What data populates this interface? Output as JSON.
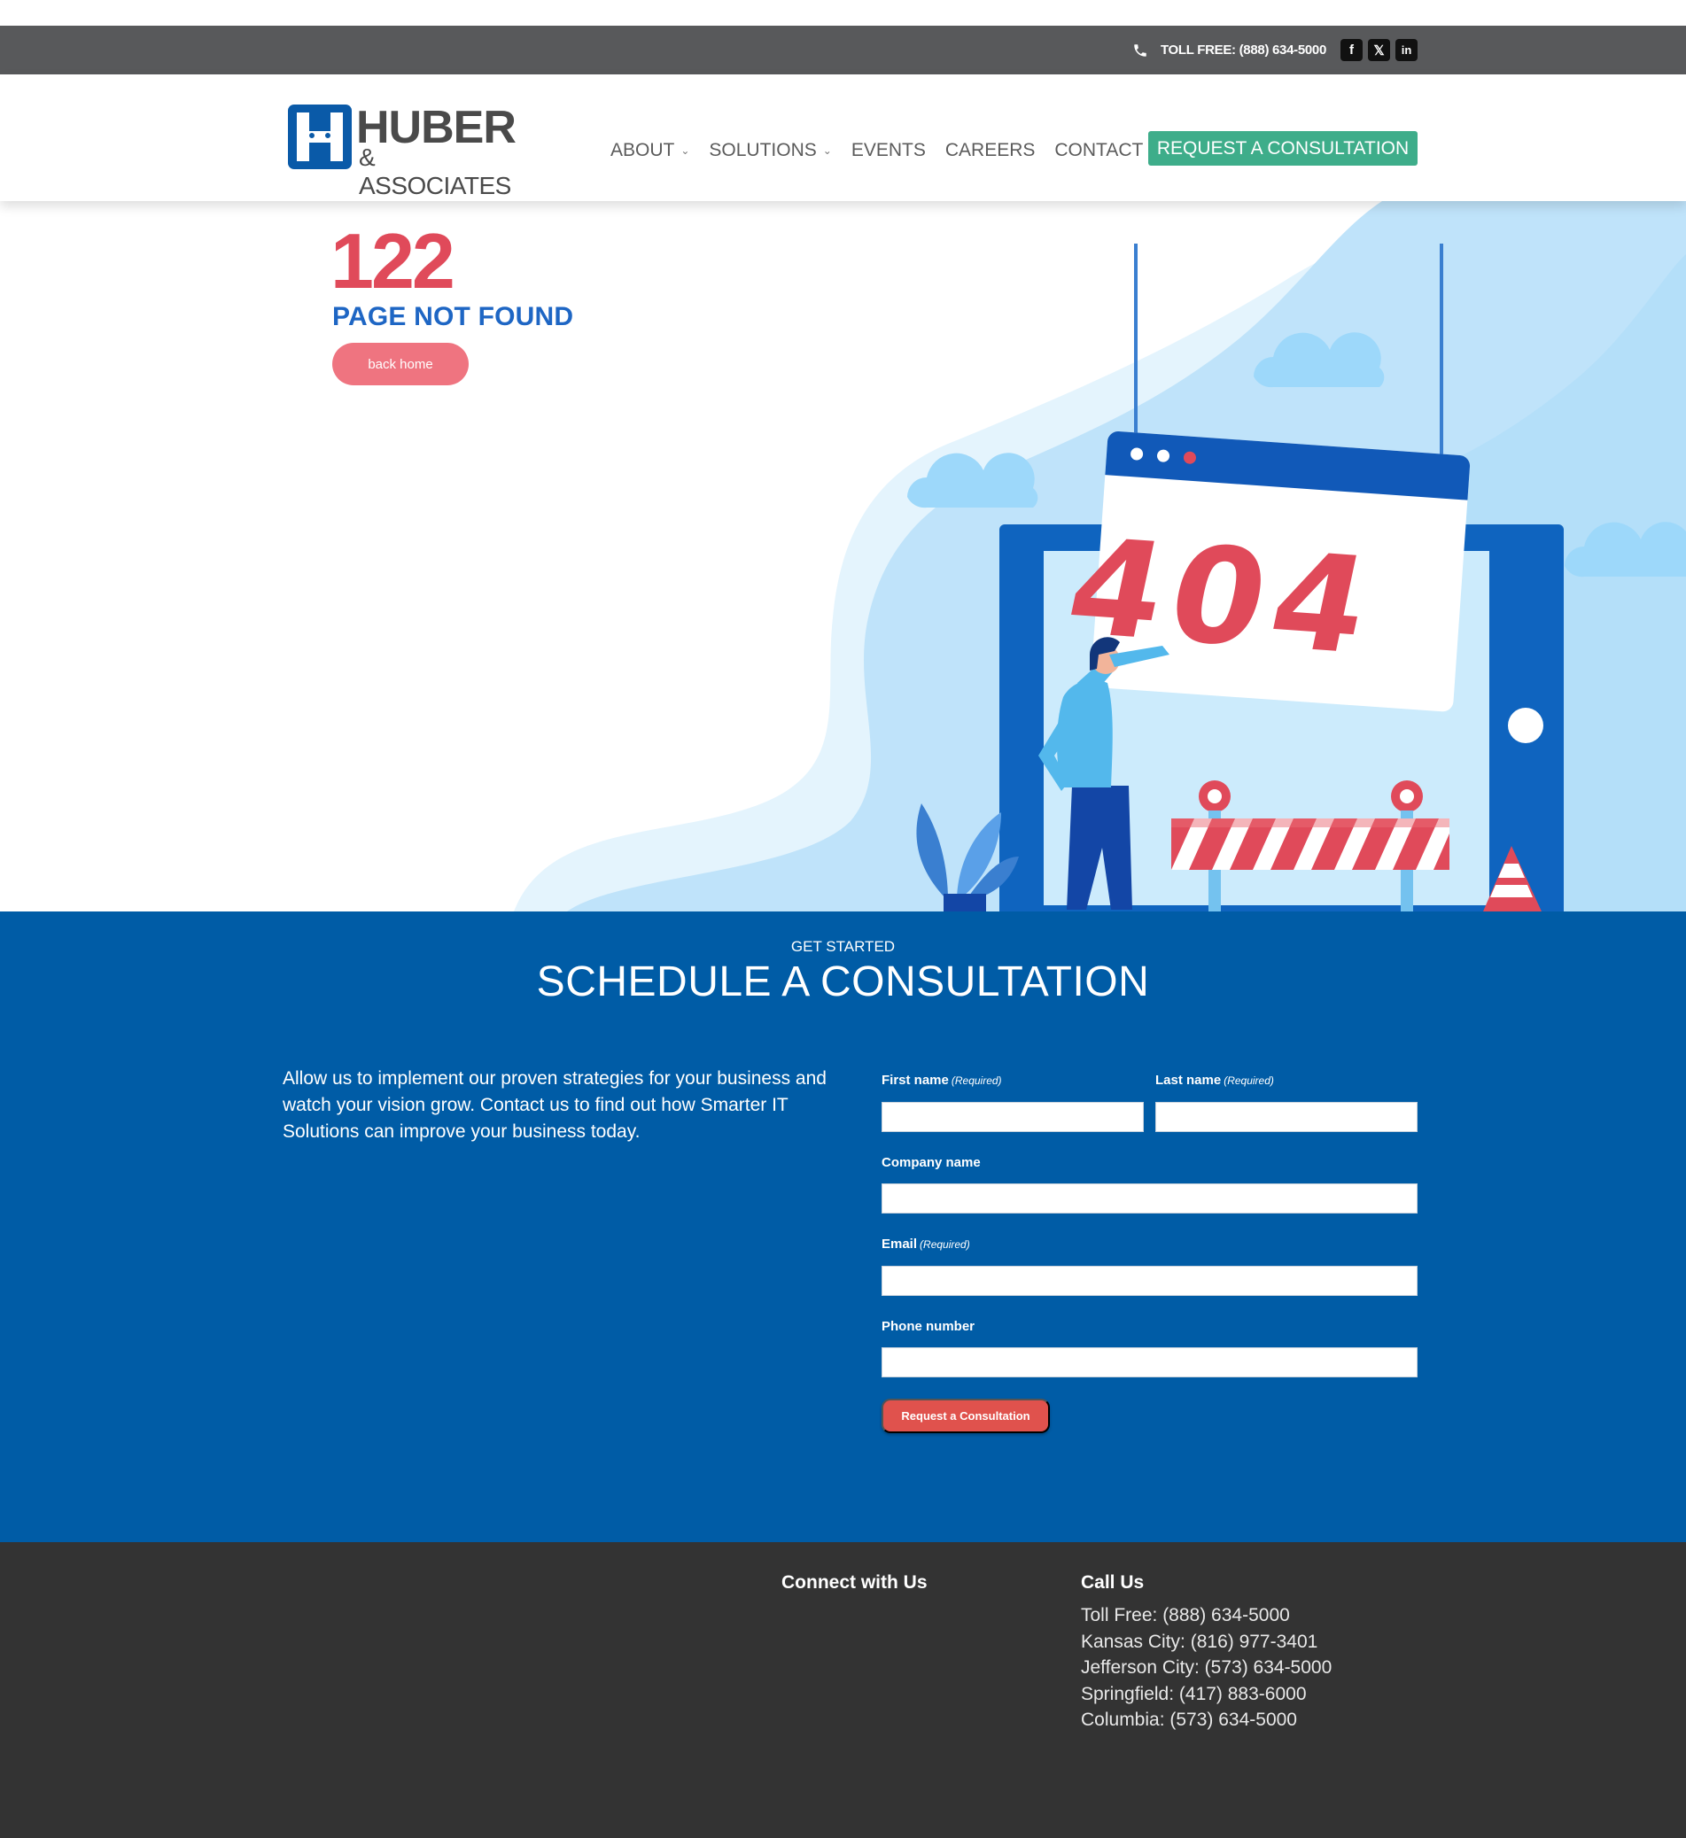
{
  "topbar": {
    "tollfree_label": "TOLL FREE: (888) 634-5000",
    "social": [
      {
        "name": "facebook-icon",
        "glyph": "f"
      },
      {
        "name": "x-twitter-icon",
        "glyph": "𝕏"
      },
      {
        "name": "linkedin-icon",
        "glyph": "in"
      }
    ]
  },
  "header": {
    "logo_line1": "HUBER",
    "logo_line2": "& ASSOCIATES",
    "nav": [
      {
        "label": "ABOUT",
        "has_dropdown": true
      },
      {
        "label": "SOLUTIONS",
        "has_dropdown": true
      },
      {
        "label": "EVENTS",
        "has_dropdown": false
      },
      {
        "label": "CAREERS",
        "has_dropdown": false
      },
      {
        "label": "CONTACT",
        "has_dropdown": false
      }
    ],
    "dropdown_glyph": "⌄",
    "cta_label": "REQUEST A CONSULTATION"
  },
  "hero": {
    "error_number": "122",
    "heading": "PAGE NOT FOUND",
    "back_button": "back home",
    "illustration_text": "404"
  },
  "consult": {
    "eyebrow": "GET STARTED",
    "title": "SCHEDULE A CONSULTATION",
    "intro": "Allow us to implement our proven strategies for your business and watch your vision grow. Contact us to find out how Smarter IT Solutions can improve your business today.",
    "required_tag": "(Required)",
    "fields": {
      "first_name": "First name",
      "last_name": "Last name",
      "company": "Company name",
      "email": "Email",
      "phone": "Phone number"
    },
    "submit_label": "Request a Consultation"
  },
  "footer": {
    "connect_title": "Connect with Us",
    "call_title": "Call Us",
    "phones": [
      "Toll Free: (888) 634-5000",
      "Kansas City: (816) 977-3401",
      "Jefferson City: (573) 634-5000",
      "Springfield: (417) 883-6000",
      "Columbia: (573) 634-5000"
    ]
  },
  "colors": {
    "topbar": "#58595b",
    "brand_blue": "#005ca6",
    "cta_green": "#3ead8a",
    "error_red": "#e04a5a",
    "footer": "#333333"
  }
}
